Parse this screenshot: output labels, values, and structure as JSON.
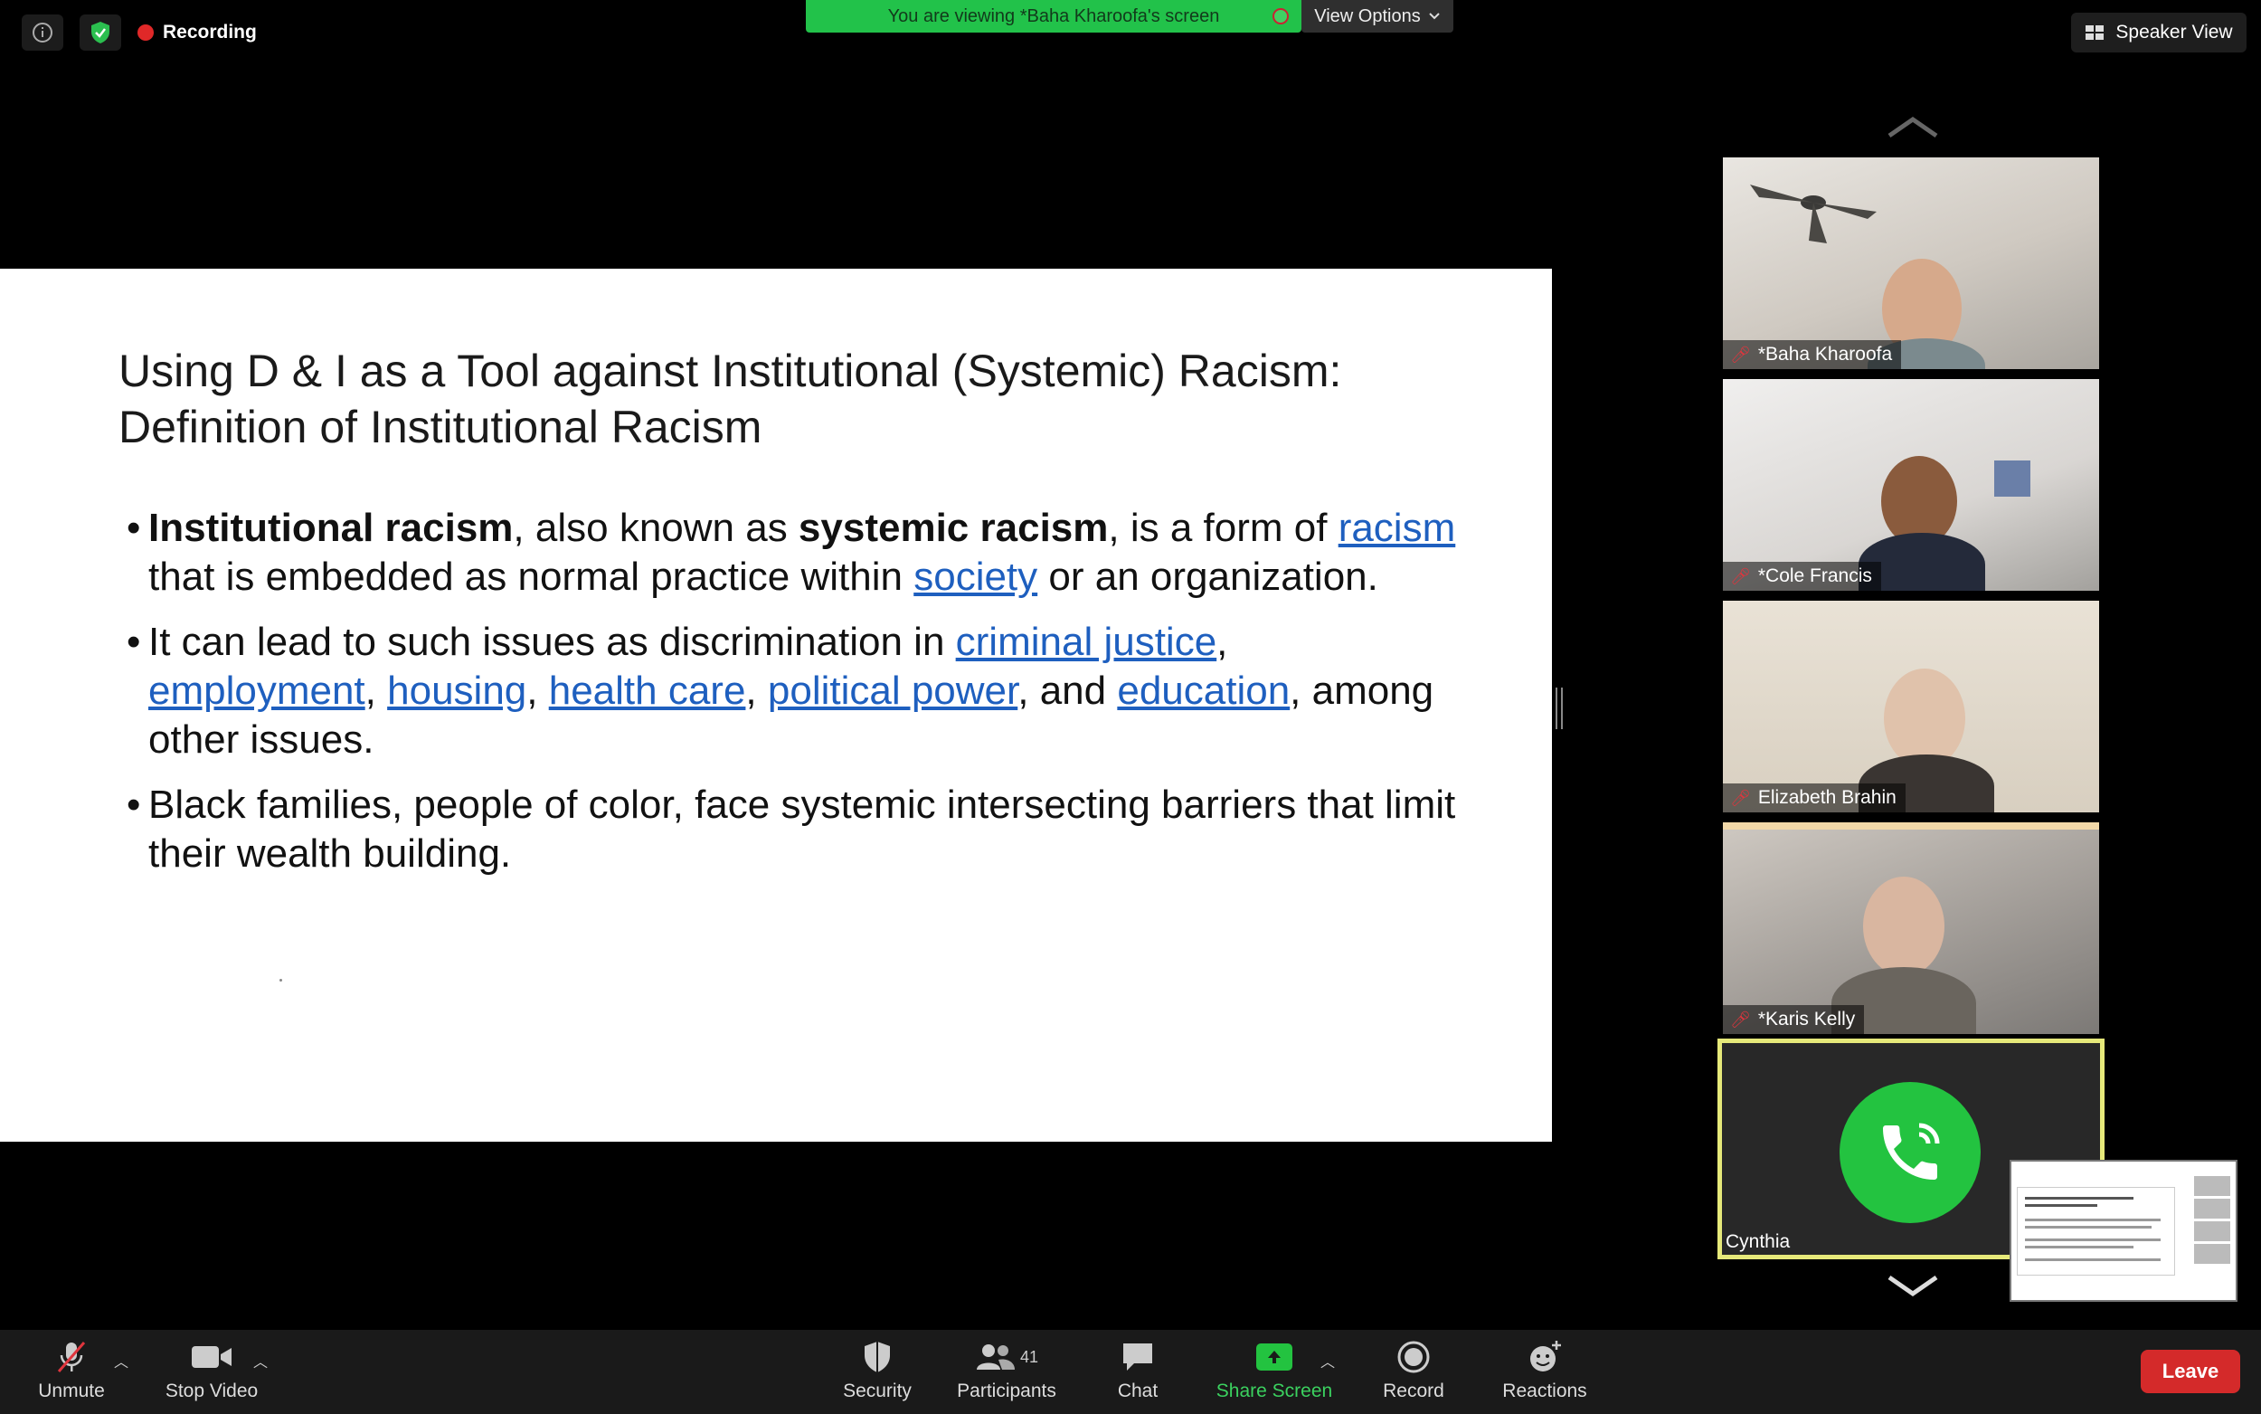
{
  "top_bar": {
    "recording_label": "Recording",
    "share_banner": "You are viewing *Baha Kharoofa's screen",
    "view_options": "View Options",
    "speaker_view": "Speaker View"
  },
  "slide": {
    "title_line1": "Using D & I as a Tool against Institutional (Systemic) Racism:",
    "title_line2": "Definition of Institutional Racism",
    "bullet1": {
      "t1": "Institutional racism",
      "t2": ", also known as ",
      "t3": "systemic racism",
      "t4": ", is a form of ",
      "link1": "racism",
      "t5": " that is embedded as normal practice within ",
      "link2": "society",
      "t6": " or an organization."
    },
    "bullet2": {
      "t1": "It can lead to such issues as discrimination in ",
      "link1": "criminal justice",
      "sep1": ", ",
      "link2": "employment",
      "sep2": ", ",
      "link3": "housing",
      "sep3": ", ",
      "link4": "health care",
      "sep4": ", ",
      "link5": "political power",
      "t2": ", and ",
      "link6": "education",
      "t3": ", among other issues."
    },
    "bullet3": "Black families, people of color, face systemic intersecting barriers that limit their wealth building."
  },
  "participants": [
    {
      "name": "*Baha Kharoofa",
      "muted": true
    },
    {
      "name": "*Cole Francis",
      "muted": true
    },
    {
      "name": "Elizabeth Brahin",
      "muted": true
    },
    {
      "name": "*Karis Kelly",
      "muted": true
    }
  ],
  "self_tile": {
    "name": "Cynthia"
  },
  "toolbar": {
    "unmute": "Unmute",
    "stop_video": "Stop Video",
    "security": "Security",
    "participants": "Participants",
    "participant_count": "41",
    "chat": "Chat",
    "share_screen": "Share Screen",
    "record": "Record",
    "reactions": "Reactions",
    "leave": "Leave"
  },
  "colors": {
    "accent_green": "#23c340",
    "leave_red": "#d42a2a",
    "link_blue": "#1e5fbf",
    "active_border": "#e6e97a"
  }
}
